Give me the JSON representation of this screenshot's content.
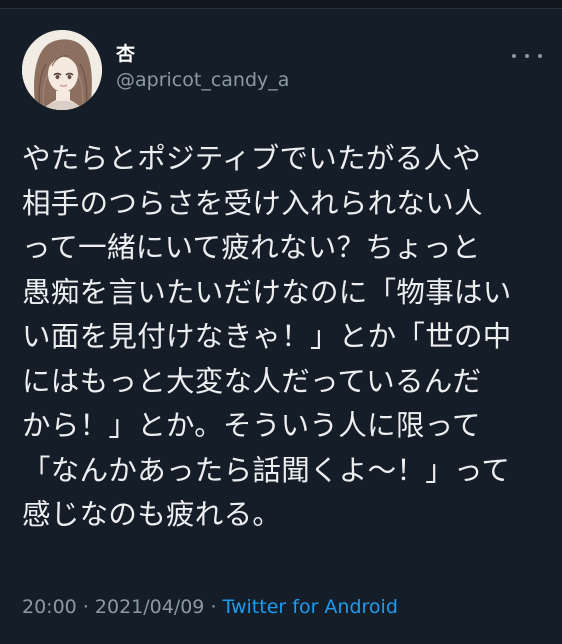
{
  "user": {
    "display_name": "杏",
    "handle": "@apricot_candy_a"
  },
  "tweet": {
    "lines": [
      "やたらとポジティブでいたがる人や",
      "相手のつらさを受け入れられない人",
      "って一緒にいて疲れない？ちょっと",
      "愚痴を言いたいだけなのに「物事はい",
      "い面を見付けなきゃ！」とか「世の中",
      "にはもっと大変な人だっているんだ",
      "から！」とか。そういう人に限って",
      "「なんかあったら話聞くよ〜！」って",
      "感じなのも疲れる。"
    ]
  },
  "meta": {
    "time": "20:00",
    "separator1": " · ",
    "date": "2021/04/09",
    "separator2": " · ",
    "source": "Twitter for Android"
  },
  "icons": {
    "more": "more-options-icon",
    "avatar": "avatar"
  },
  "colors": {
    "background": "#151e28",
    "text": "#eceef0",
    "secondary": "#8b98a5",
    "accent": "#1d9bf0"
  }
}
